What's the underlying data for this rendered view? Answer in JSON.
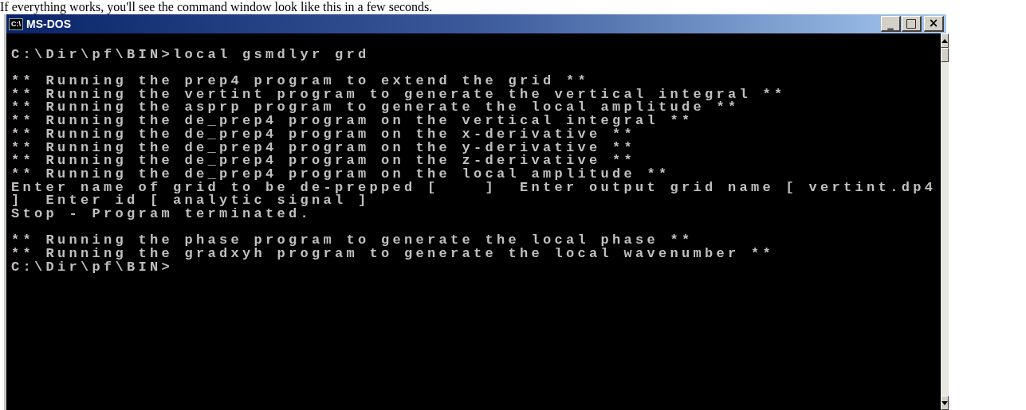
{
  "caption": "If everything works, you'll see the command window look like this in a few seconds.",
  "window": {
    "title": "MS-DOS",
    "icon_text": "C:\\",
    "controls": [
      "_",
      "□",
      "×"
    ]
  },
  "console": {
    "blocks": [
      [
        "C:\\Dir\\pf\\BIN>local gsmdlyr grd"
      ],
      [
        "** Running the prep4 program to extend the grid **",
        "** Running the vertint program to generate the vertical integral **",
        "** Running the asprp program to generate the local amplitude **",
        "** Running the de_prep4 program on the vertical integral **",
        "** Running the de_prep4 program on the x-derivative **",
        "** Running the de_prep4 program on the y-derivative **",
        "** Running the de_prep4 program on the z-derivative **",
        "** Running the de_prep4 program on the local amplitude **",
        "Enter name of grid to be de-prepped [    ]  Enter output grid name [ vertint.dp4",
        "]  Enter id [ analytic signal ]",
        "Stop - Program terminated."
      ],
      [
        "** Running the phase program to generate the local phase **",
        "** Running the gradxyh program to generate the local wavenumber **",
        "C:\\Dir\\pf\\BIN>"
      ]
    ]
  }
}
